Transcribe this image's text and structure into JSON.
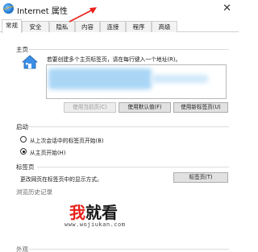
{
  "window": {
    "title": "Internet 属性",
    "close_glyph": "✕"
  },
  "tabs": [
    "常规",
    "安全",
    "隐私",
    "内容",
    "连接",
    "程序",
    "高级"
  ],
  "active_tab": 0,
  "homepage": {
    "heading": "主页",
    "description": "若要创建多个主页标签页，请在每行键入一个地址(R)。",
    "url_value": "",
    "buttons": {
      "use_current": "使用当前页(C)",
      "use_default": "使用默认值(F)",
      "use_new_tab": "使用新标签页(U)"
    }
  },
  "startup": {
    "heading": "启动",
    "options": [
      "从上次会话中的标签页开始(B)",
      "从主页开始(H)"
    ],
    "selected_index": 1
  },
  "tabs_section": {
    "heading": "标签页",
    "description": "更改网页在标签页中的显示方式。",
    "button": "标签页(T)"
  },
  "history": {
    "heading": "浏览历史记录"
  },
  "appearance": {
    "heading": "外观"
  },
  "watermark": {
    "main_accent": "我",
    "main_rest": "就看",
    "sub": "www.wojiukan.com"
  },
  "colors": {
    "annotation_arrow": "#e8211c",
    "url_highlight": "#a9d6f5",
    "watermark_accent": "#e8211c"
  },
  "icons": {
    "app": "internet-globe-icon",
    "homepage": "house-icon",
    "close": "close-icon"
  }
}
